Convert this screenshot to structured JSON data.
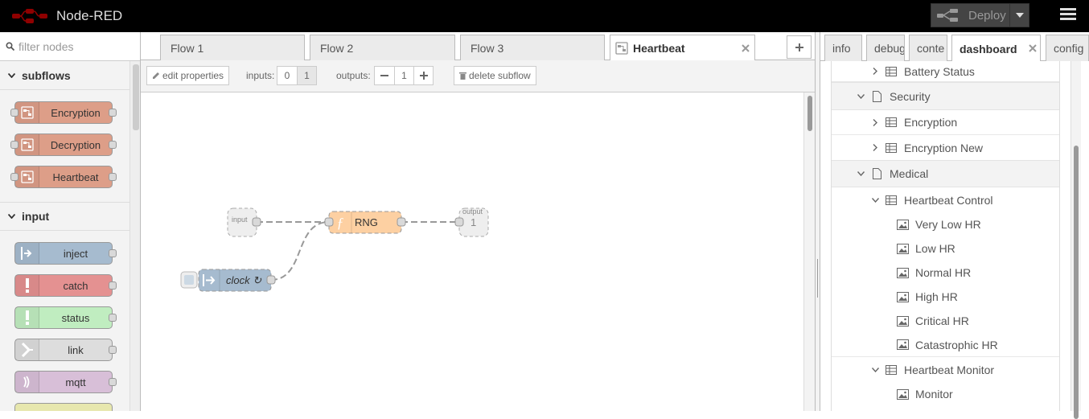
{
  "app": {
    "title": "Node-RED"
  },
  "header": {
    "deploy_label": "Deploy"
  },
  "palette": {
    "search_placeholder": "filter nodes",
    "categories": [
      {
        "label": "subflows",
        "nodes": [
          "Encryption",
          "Decryption",
          "Heartbeat"
        ]
      },
      {
        "label": "input",
        "nodes": [
          "inject",
          "catch",
          "status",
          "link",
          "mqtt"
        ]
      }
    ]
  },
  "workspace": {
    "tabs": [
      "Flow 1",
      "Flow 2",
      "Flow 3",
      "Heartbeat"
    ],
    "active_tab": "Heartbeat",
    "subflow": {
      "edit_properties": "edit properties",
      "inputs_label": "inputs:",
      "inputs_options": [
        "0",
        "1"
      ],
      "outputs_label": "outputs:",
      "outputs_value": "1",
      "delete_subflow": "delete subflow"
    },
    "nodes": {
      "input_port": "input",
      "function_label": "RNG",
      "output_port_label": "output",
      "output_port_number": "1",
      "inject_label": "clock ↻"
    }
  },
  "sidebar": {
    "tabs": [
      "info",
      "debug",
      "conte",
      "dashboard",
      "config"
    ],
    "active_tab": "dashboard",
    "tree": [
      {
        "label": "Battery Status",
        "kind": "group-ref"
      },
      {
        "label": "Security",
        "kind": "tab"
      },
      {
        "label": "Encryption",
        "kind": "group-ref"
      },
      {
        "label": "Encryption New",
        "kind": "group-ref"
      },
      {
        "label": "Medical",
        "kind": "tab"
      },
      {
        "label": "Heartbeat Control",
        "kind": "group"
      },
      {
        "label": "Very Low HR",
        "kind": "widget"
      },
      {
        "label": "Low HR",
        "kind": "widget"
      },
      {
        "label": "Normal HR",
        "kind": "widget"
      },
      {
        "label": "High HR",
        "kind": "widget"
      },
      {
        "label": "Critical HR",
        "kind": "widget"
      },
      {
        "label": "Catastrophic HR",
        "kind": "widget"
      },
      {
        "label": "Heartbeat Monitor",
        "kind": "group"
      },
      {
        "label": "Monitor",
        "kind": "widget"
      }
    ]
  },
  "colors": {
    "subflow_node": "#dd9e88",
    "inject": "#a6bbcf",
    "catch": "#e49191",
    "status": "#c0edc0",
    "link": "#dddddd",
    "mqtt": "#d8bfd8",
    "function": "#fdd0a2"
  }
}
